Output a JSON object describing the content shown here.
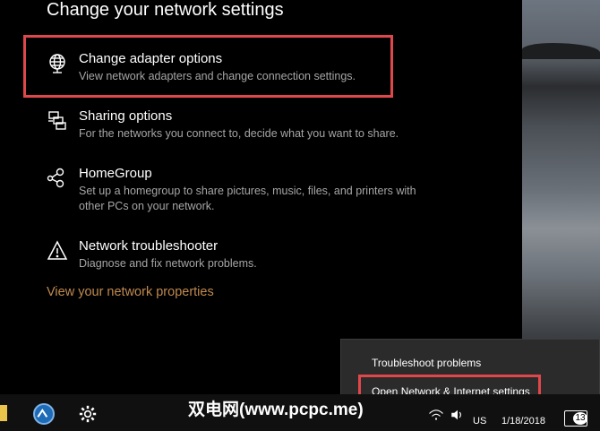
{
  "settings": {
    "section_title": "Change your network settings",
    "items": [
      {
        "title": "Change adapter options",
        "desc": "View network adapters and change connection settings.",
        "icon": "globe-network-icon"
      },
      {
        "title": "Sharing options",
        "desc": "For the networks you connect to, decide what you want to share.",
        "icon": "sharing-icon"
      },
      {
        "title": "HomeGroup",
        "desc": "Set up a homegroup to share pictures, music, files, and printers with other PCs on your network.",
        "icon": "homegroup-icon"
      },
      {
        "title": "Network troubleshooter",
        "desc": "Diagnose and fix network problems.",
        "icon": "warning-icon"
      }
    ],
    "properties_link": "View your network properties"
  },
  "context_menu": {
    "items": [
      "Troubleshoot problems",
      "Open Network & Internet settings"
    ]
  },
  "taskbar": {
    "watermark": "双电网(www.pcpc.me)",
    "language": "US",
    "date": "1/18/2018",
    "notification_count": "13"
  },
  "colors": {
    "highlight": "#e0474b",
    "link": "#c08a4f",
    "desc": "#a6a6a6"
  }
}
